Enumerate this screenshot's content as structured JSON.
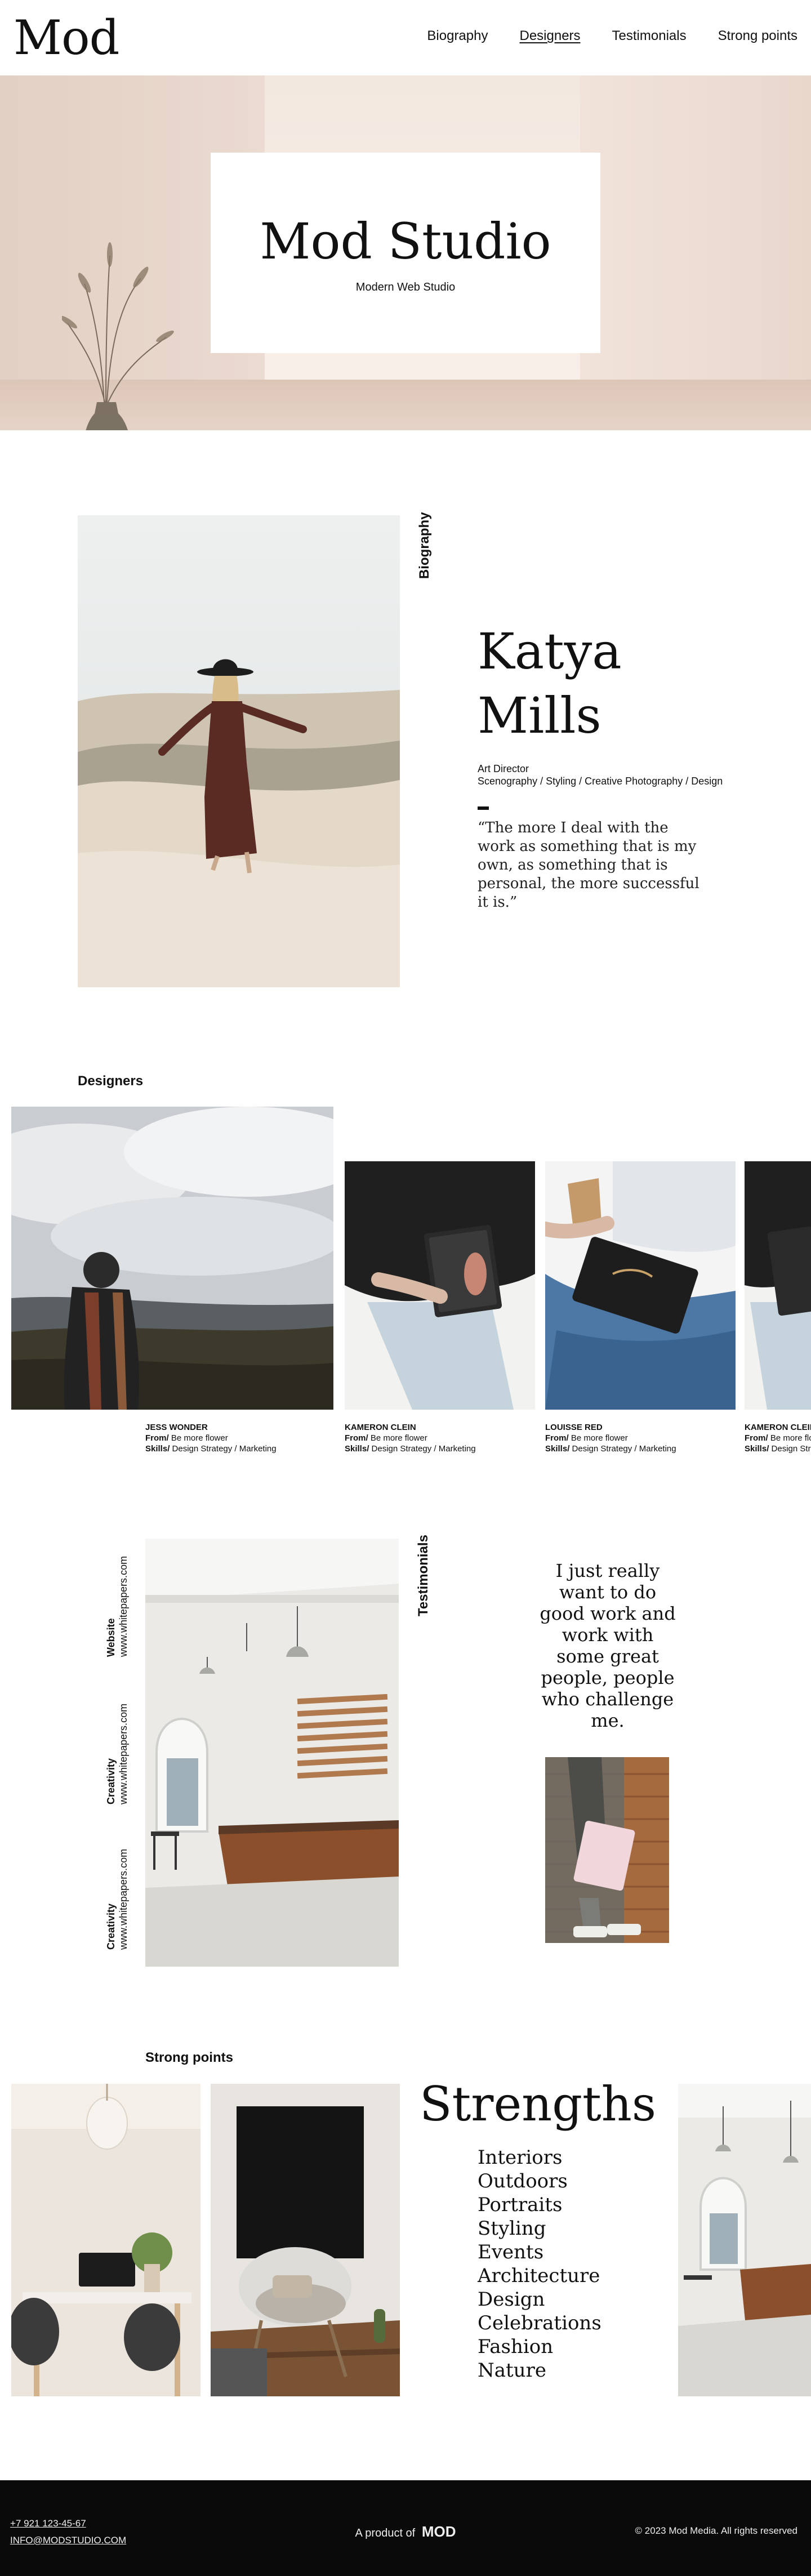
{
  "header": {
    "logo": "Mod",
    "nav": [
      "Biography",
      "Designers",
      "Testimonials",
      "Strong points"
    ]
  },
  "hero": {
    "title": "Mod Studio",
    "subtitle": "Modern Web Studio"
  },
  "biography": {
    "label": "Biography",
    "name_first": "Katya",
    "name_last": "Mills",
    "role": "Art Director",
    "skills": "Scenography / Styling / Creative Photography / Design",
    "quote": "“The more I deal with the work as something that is my own, as something that is personal, the more successful it is.”"
  },
  "designers": {
    "label": "Designers",
    "from_label": "From/",
    "skills_label": "Skills/",
    "cards": [
      {
        "name": "Jess Wonder",
        "from": "Be more flower",
        "skills": "Design Strategy / Marketing"
      },
      {
        "name": "Kameron Clein",
        "from": "Be more flower",
        "skills": "Design Strategy / Marketing"
      },
      {
        "name": "Louisse Red",
        "from": "Be more flower",
        "skills": "Design Strategy / Marketing"
      },
      {
        "name": "Kameron Clein",
        "from": "Be more flower",
        "skills": "Design Strategy / Marketing"
      }
    ]
  },
  "testimonials": {
    "label": "Testimonials",
    "side": [
      {
        "title": "Website",
        "value": "www.whitepapers.com"
      },
      {
        "title": "Creativity",
        "value": "www.whitepapers.com"
      },
      {
        "title": "Creativity",
        "value": "www.whitepapers.com"
      }
    ],
    "quote": "I just really want to do good work and work with some great people, people who challenge me."
  },
  "strong_points": {
    "label": "Strong points",
    "title": "Strengths",
    "items": [
      "Interiors",
      "Outdoors",
      "Portraits",
      "Styling",
      "Events",
      "Architecture",
      "Design",
      "Celebrations",
      "Fashion",
      "Nature"
    ]
  },
  "footer": {
    "phone": "+7 921 123-45-67",
    "email": "INFO@MODSTUDIO.COM",
    "product_prefix": "A product of",
    "brand": "MOD",
    "copyright": "© 2023 Mod Media. All rights reserved"
  }
}
